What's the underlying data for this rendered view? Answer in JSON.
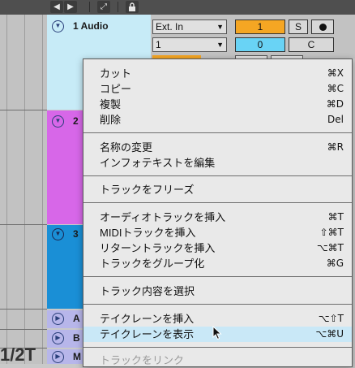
{
  "toolbar": {
    "icons": [
      "arrow-left-right-icon",
      "expand-icon",
      "lock-icon"
    ]
  },
  "tracks": [
    {
      "name": "1 Audio",
      "color": "#c7ebf7"
    },
    {
      "name": "2",
      "color": "#d767e8"
    },
    {
      "name": "3",
      "color": "#1a8fd6"
    },
    {
      "name": "A",
      "color": "#b7b6ea"
    },
    {
      "name": "B",
      "color": "#b7b6ea"
    },
    {
      "name": "M",
      "color": "#b7b6ea"
    }
  ],
  "io": {
    "input_type": "Ext. In",
    "input_channel": "1"
  },
  "mixer": {
    "track_number": "1",
    "solo_label": "S",
    "value": "0",
    "pan": "C"
  },
  "background_label": "1/2T",
  "context_menu": {
    "groups": [
      [
        {
          "label": "カット",
          "shortcut": "⌘X"
        },
        {
          "label": "コピー",
          "shortcut": "⌘C"
        },
        {
          "label": "複製",
          "shortcut": "⌘D"
        },
        {
          "label": "削除",
          "shortcut": "Del"
        }
      ],
      [
        {
          "label": "名称の変更",
          "shortcut": "⌘R"
        },
        {
          "label": "インフォテキストを編集",
          "shortcut": ""
        }
      ],
      [
        {
          "label": "トラックをフリーズ",
          "shortcut": ""
        }
      ],
      [
        {
          "label": "オーディオトラックを挿入",
          "shortcut": "⌘T"
        },
        {
          "label": "MIDIトラックを挿入",
          "shortcut": "⇧⌘T"
        },
        {
          "label": "リターントラックを挿入",
          "shortcut": "⌥⌘T"
        },
        {
          "label": "トラックをグループ化",
          "shortcut": "⌘G"
        }
      ],
      [
        {
          "label": "トラック内容を選択",
          "shortcut": ""
        }
      ],
      [
        {
          "label": "テイクレーンを挿入",
          "shortcut": "⌥⇧T"
        },
        {
          "label": "テイクレーンを表示",
          "shortcut": "⌥⌘U"
        }
      ],
      [
        {
          "label": "トラックをリンク",
          "shortcut": ""
        }
      ]
    ],
    "highlighted_item": "テイクレーンを表示",
    "highlight_color": "#c9e8f7"
  }
}
